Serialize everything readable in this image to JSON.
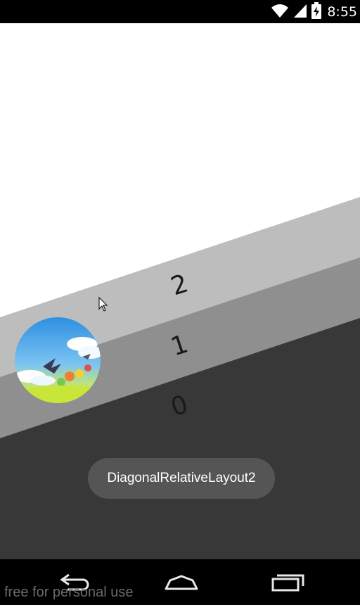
{
  "status_bar": {
    "time": "8:55",
    "icons": [
      "wifi-icon",
      "cell-signal-icon",
      "battery-charging-icon"
    ]
  },
  "layers": [
    {
      "label": "2",
      "color": "#bdbdbd"
    },
    {
      "label": "1",
      "color": "#8f8f8f"
    },
    {
      "label": "0",
      "color": "#383838"
    }
  ],
  "toast": {
    "text": "DiagonalRelativeLayout2"
  },
  "nav_bar": {
    "buttons": [
      "back-icon",
      "home-icon",
      "recents-icon"
    ]
  },
  "watermark": "free for personal use",
  "colors": {
    "background": "#ffffff",
    "band_light": "#bdbdbd",
    "band_mid": "#8f8f8f",
    "band_dark": "#383838",
    "toast_bg": "#555555",
    "bars": "#000000"
  }
}
